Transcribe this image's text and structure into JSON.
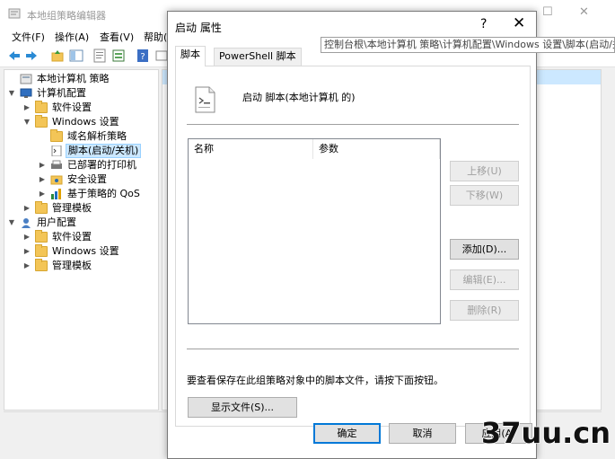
{
  "mmc": {
    "title": "本地组策略编辑器",
    "menu": [
      "文件(F)",
      "操作(A)",
      "查看(V)",
      "帮助("
    ],
    "tree": [
      {
        "label": "本地计算机 策略",
        "level": 0,
        "expander": "",
        "icon": "policy-icon"
      },
      {
        "label": "计算机配置",
        "level": 0,
        "expander": "▼",
        "icon": "computer-icon"
      },
      {
        "label": "软件设置",
        "level": 1,
        "expander": "▶",
        "icon": "folder-icon"
      },
      {
        "label": "Windows 设置",
        "level": 1,
        "expander": "▼",
        "icon": "folder-icon"
      },
      {
        "label": "域名解析策略",
        "level": 2,
        "expander": "",
        "icon": "folder-icon"
      },
      {
        "label": "脚本(启动/关机)",
        "level": 2,
        "expander": "",
        "icon": "script-icon",
        "selected": true
      },
      {
        "label": "已部署的打印机",
        "level": 2,
        "expander": "▶",
        "icon": "printer-icon"
      },
      {
        "label": "安全设置",
        "level": 2,
        "expander": "▶",
        "icon": "security-icon"
      },
      {
        "label": "基于策略的 QoS",
        "level": 2,
        "expander": "▶",
        "icon": "chart-icon"
      },
      {
        "label": "管理模板",
        "level": 1,
        "expander": "▶",
        "icon": "folder-icon"
      },
      {
        "label": "用户配置",
        "level": 0,
        "expander": "▼",
        "icon": "user-icon"
      },
      {
        "label": "软件设置",
        "level": 1,
        "expander": "▶",
        "icon": "folder-icon"
      },
      {
        "label": "Windows 设置",
        "level": 1,
        "expander": "▶",
        "icon": "folder-icon"
      },
      {
        "label": "管理模板",
        "level": 1,
        "expander": "▶",
        "icon": "folder-icon"
      }
    ]
  },
  "dialog": {
    "title": "启动 属性",
    "help_glyph": "?",
    "close_glyph": "✕",
    "tabs": [
      "脚本",
      "PowerShell 脚本"
    ],
    "active_tab": 0,
    "heading": "启动 脚本(本地计算机 的)",
    "table": {
      "columns": [
        "名称",
        "参数"
      ],
      "rows": []
    },
    "buttons": {
      "up": "上移(U)",
      "down": "下移(W)",
      "add": "添加(D)...",
      "edit": "编辑(E)...",
      "remove": "删除(R)",
      "show_files": "显示文件(S)...",
      "ok": "确定",
      "cancel": "取消",
      "apply": "应用(A)"
    },
    "note": "要查看保存在此组策略对象中的脚本文件，请按下面按钮。"
  },
  "breadcrumb": "控制台根\\本地计算机 策略\\计算机配置\\Windows 设置\\脚本(启动/关",
  "watermark": "37uu.cn"
}
